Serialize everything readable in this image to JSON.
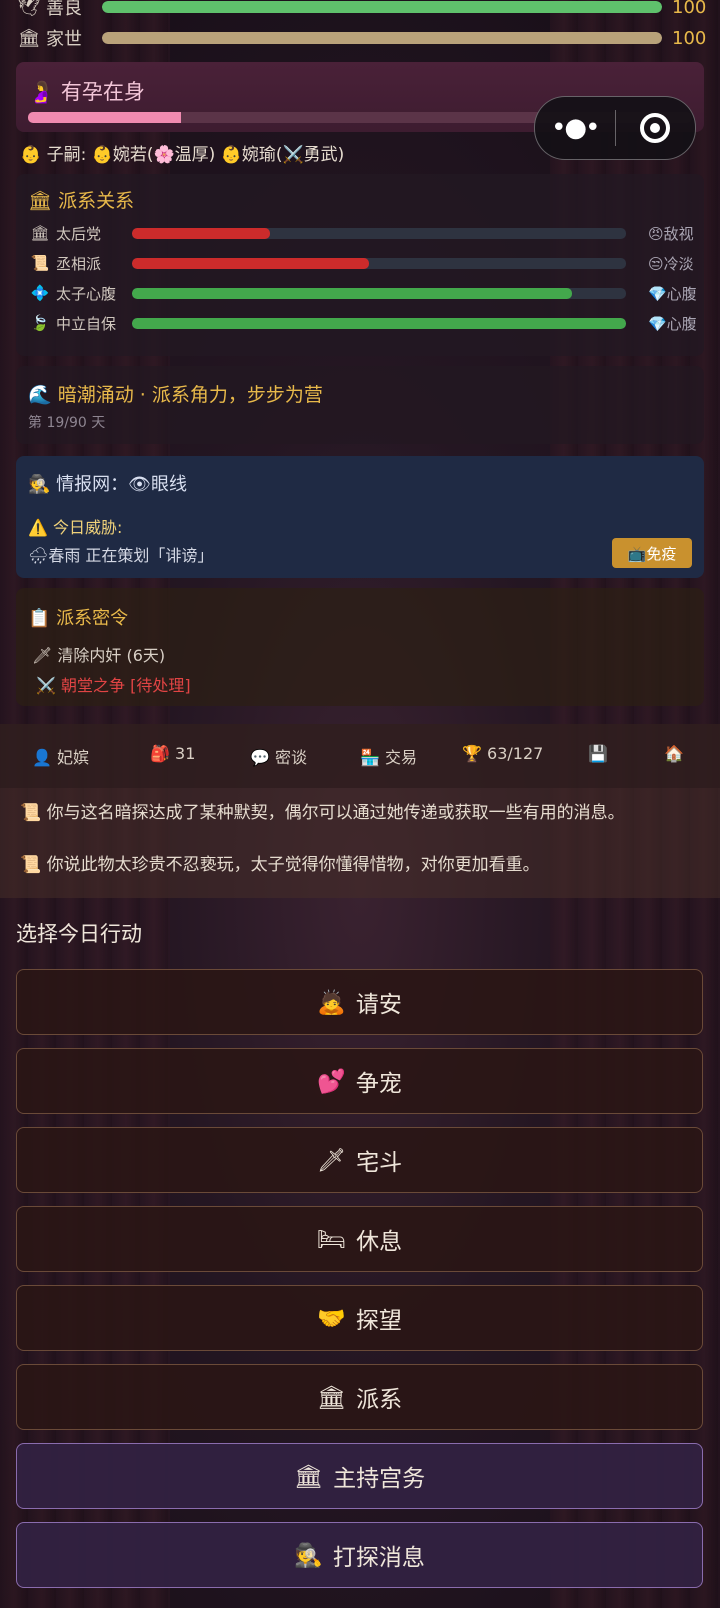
{
  "stats": [
    {
      "icon": "🕊",
      "label": "善良",
      "value": "100",
      "fill_pct": 100,
      "color": "#5fc16c"
    },
    {
      "icon": "🏛",
      "label": "家世",
      "value": "100",
      "fill_pct": 100,
      "color": "#b9a27a"
    }
  ],
  "pregnancy": {
    "icon": "🤰",
    "title": "有孕在身",
    "progress_pct": 23
  },
  "children": {
    "text": "👶 子嗣: 👶婉若(🌸温厚) 👶婉瑜(⚔️勇武)"
  },
  "factions": {
    "title": "🏛 派系关系",
    "items": [
      {
        "icon": "🏛",
        "name": "太后党",
        "pct": 28,
        "color": "#cc2b2b",
        "status": "😠敌视"
      },
      {
        "icon": "📜",
        "name": "丞相派",
        "pct": 48,
        "color": "#cc2b2b",
        "status": "😒冷淡"
      },
      {
        "icon": "💠",
        "name": "太子心腹",
        "pct": 89,
        "color": "#43a84c",
        "status": "💎心腹"
      },
      {
        "icon": "🍃",
        "name": "中立自保",
        "pct": 100,
        "color": "#43a84c",
        "status": "💎心腹"
      }
    ]
  },
  "event": {
    "title": "🌊 暗潮涌动 · 派系角力，步步为营",
    "day": "第 19/90 天"
  },
  "intel": {
    "network": "🕵 情报网：👁眼线",
    "threat_label": "⚠️ 今日威胁:",
    "plot": "🌧春雨 正在策划「诽谤」",
    "immune_button": "📺免疫"
  },
  "orders": {
    "title": "📋 派系密令",
    "items": [
      "🗡 清除内奸 (6天)",
      "⚔️ 朝堂之争 [待处理]"
    ]
  },
  "nav": [
    {
      "label": "👤 妃嫔"
    },
    {
      "label": "🎒 31"
    },
    {
      "label": "💬 密谈"
    },
    {
      "label": "🏪 交易"
    },
    {
      "label": "🏆 63/127"
    },
    {
      "label": "💾"
    },
    {
      "label": "🏠"
    }
  ],
  "log": [
    "📜 你与这名暗探达成了某种默契，偶尔可以通过她传递或获取一些有用的消息。",
    "📜 你说此物太珍贵不忍亵玩，太子觉得你懂得惜物，对你更加看重。"
  ],
  "actions_title": "选择今日行动",
  "actions": [
    {
      "icon": "🙇",
      "label": "请安",
      "style": "normal"
    },
    {
      "icon": "💕",
      "label": "争宠",
      "style": "normal"
    },
    {
      "icon": "🗡",
      "label": "宅斗",
      "style": "normal"
    },
    {
      "icon": "🛏",
      "label": "休息",
      "style": "normal"
    },
    {
      "icon": "🤝",
      "label": "探望",
      "style": "normal"
    },
    {
      "icon": "🏛",
      "label": "派系",
      "style": "normal"
    },
    {
      "icon": "🏛",
      "label": "主持宫务",
      "style": "purple"
    },
    {
      "icon": "🕵",
      "label": "打探消息",
      "style": "purple"
    }
  ]
}
